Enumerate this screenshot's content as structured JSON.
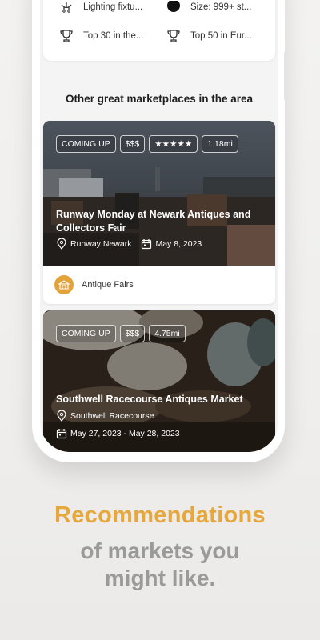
{
  "features": {
    "lighting": "Lighting fixtu...",
    "size": "Size: 999+ st...",
    "top30": "Top 30 in the...",
    "top50": "Top 50 in Eur..."
  },
  "section_title": "Other great marketplaces in the area",
  "markets": [
    {
      "tags": [
        "COMING UP",
        "$$$",
        "★★★★★",
        "1.18mi"
      ],
      "title": "Runway Monday at Newark Antiques and Collectors Fair",
      "location": "Runway Newark",
      "date": "May 8, 2023",
      "category": "Antique Fairs"
    },
    {
      "tags": [
        "COMING UP",
        "$$$",
        "4.75mi"
      ],
      "title": "Southwell Racecourse Antiques Market",
      "location": "Southwell Racecourse",
      "date": "May 27, 2023 - May 28, 2023"
    }
  ],
  "promo": {
    "headline": "Recommendations",
    "line1": "of markets you",
    "line2": "might like."
  },
  "colors": {
    "accent": "#e6a73c",
    "category_icon_bg": "#e3a23b",
    "subtext": "#9a9a9a"
  }
}
